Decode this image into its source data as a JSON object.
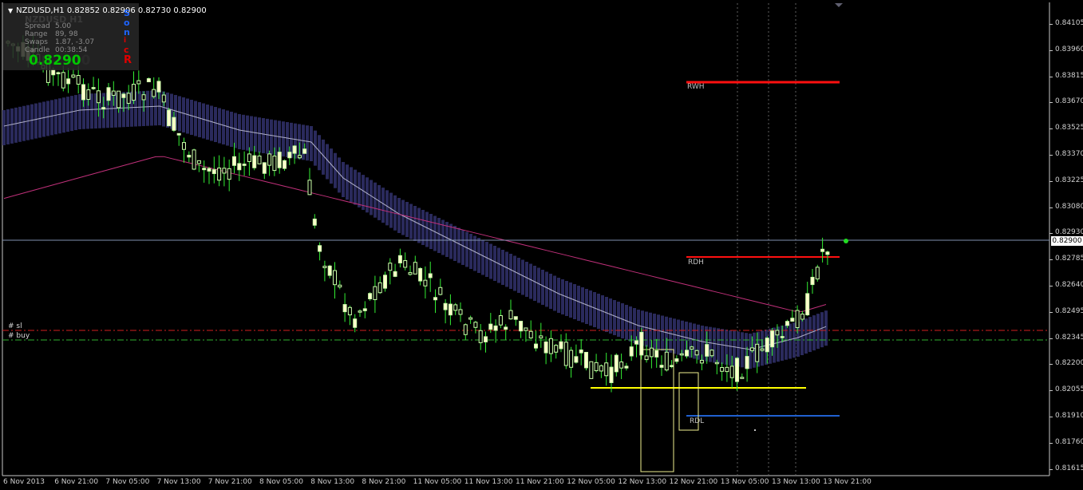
{
  "header": {
    "symbol_title": "NZDUSD,H1",
    "prices": "0.82852 0.82906 0.82730 0.82900"
  },
  "panel": {
    "faded_name": "NZDUSD H1",
    "rows": [
      {
        "label": "Spread",
        "value": "5.00"
      },
      {
        "label": "Range",
        "value": "89, 98"
      },
      {
        "label": "Swaps",
        "value": "1.87, -3.07"
      },
      {
        "label": "Candle",
        "value": "00:38:54"
      }
    ],
    "price_main": "0.8290",
    "price_tail": "0",
    "side_letters": [
      "S",
      "o",
      "n",
      "i",
      "c",
      "R"
    ],
    "colors": {
      "blue": "#1e64ff",
      "red": "#e00000",
      "green": "#00c800"
    }
  },
  "levels": {
    "rwh": "RWH",
    "rdh": "RDH",
    "rdl": "RDL"
  },
  "orders": {
    "sl": "#          sl",
    "buy": "#          buy"
  },
  "price_axis": {
    "ticks": [
      "0.84105",
      "0.83960",
      "0.83815",
      "0.83670",
      "0.83525",
      "0.83370",
      "0.83225",
      "0.83080",
      "0.82930",
      "0.82785",
      "0.82640",
      "0.82495",
      "0.82345",
      "0.82200",
      "0.82055",
      "0.81910",
      "0.81760",
      "0.81615"
    ],
    "current": "0.82900"
  },
  "time_axis": [
    "6 Nov 2013",
    "6 Nov 21:00",
    "7 Nov 05:00",
    "7 Nov 13:00",
    "7 Nov 21:00",
    "8 Nov 05:00",
    "8 Nov 13:00",
    "8 Nov 21:00",
    "11 Nov 05:00",
    "11 Nov 13:00",
    "11 Nov 21:00",
    "12 Nov 05:00",
    "12 Nov 13:00",
    "12 Nov 21:00",
    "13 Nov 05:00",
    "13 Nov 13:00",
    "13 Nov 21:00"
  ],
  "colors": {
    "bg": "#000000",
    "candle": "#ccffaa",
    "bull_body": "#ffffcc",
    "wick": "#33ee33",
    "band": "#24244e",
    "band_line": "#9a9ab8",
    "ma": "#c0307a",
    "red_line": "#ff1010",
    "blue_line": "#2060d0",
    "yellow_line": "#ffff00",
    "grid": "#8080a0"
  }
}
